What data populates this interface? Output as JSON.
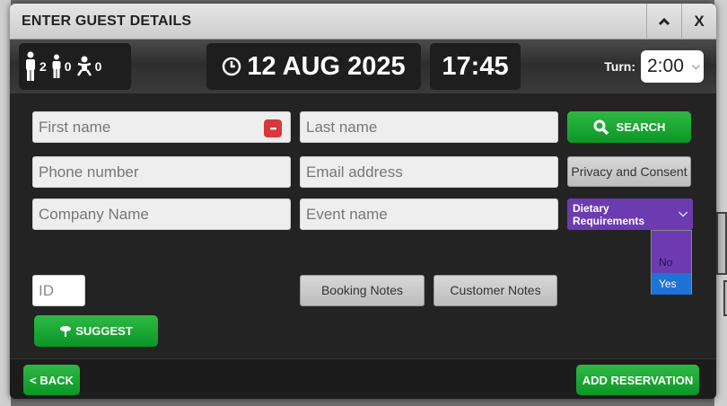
{
  "dialog": {
    "title": "ENTER GUEST DETAILS",
    "collapse_icon": "chevron-up-icon",
    "close_label": "X"
  },
  "infobar": {
    "adults": "2",
    "children": "0",
    "infants": "0",
    "date": "12 AUG 2025",
    "time": "17:45",
    "turn_label": "Turn:",
    "turn_value": "2:00"
  },
  "form": {
    "first_name_placeholder": "First name",
    "last_name_placeholder": "Last name",
    "search_label": "SEARCH",
    "phone_placeholder": "Phone number",
    "email_placeholder": "Email address",
    "privacy_label": "Privacy and Consent",
    "company_placeholder": "Company Name",
    "event_placeholder": "Event name",
    "dietary_label": "Dietary Requirements",
    "dietary_options": [
      "No",
      "Yes"
    ],
    "dietary_highlighted": "Yes",
    "id_placeholder": "ID",
    "booking_notes_label": "Booking Notes",
    "customer_notes_label": "Customer Notes",
    "suggest_label": "SUGGEST"
  },
  "footer": {
    "back_label": "< BACK",
    "add_label": "ADD RESERVATION"
  },
  "colors": {
    "green_button": "#13a02d",
    "dietary_purple": "#6c3bb0",
    "highlight_blue": "#1f73d6",
    "password_icon_red": "#d9363e"
  }
}
